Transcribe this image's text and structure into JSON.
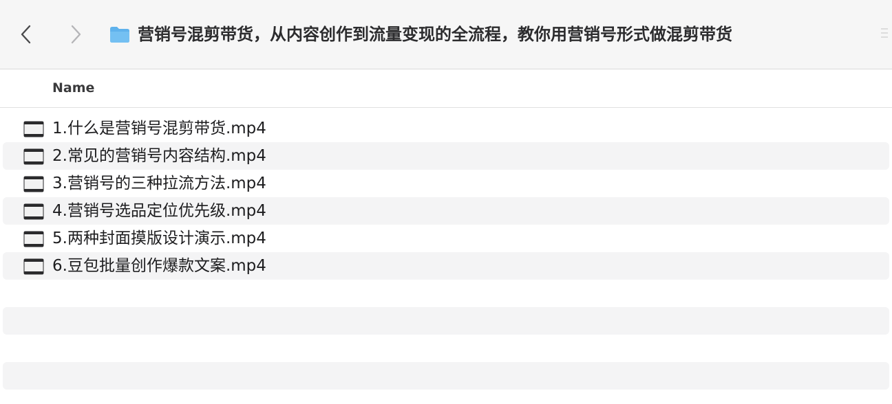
{
  "window": {
    "title": "营销号混剪带货，从内容创作到流量变现的全流程，教你用营销号形式做混剪带货"
  },
  "toolbar": {
    "back_icon": "chevron-left-icon",
    "forward_icon": "chevron-right-icon",
    "folder_icon": "folder-icon",
    "folder_color": "#5fb2ec"
  },
  "columns": {
    "name": "Name"
  },
  "files": [
    {
      "name": "1.什么是营销号混剪带货.mp4",
      "icon": "video-file-icon"
    },
    {
      "name": "2.常见的营销号内容结构.mp4",
      "icon": "video-file-icon"
    },
    {
      "name": "3.营销号的三种拉流方法.mp4",
      "icon": "video-file-icon"
    },
    {
      "name": "4.营销号选品定位优先级.mp4",
      "icon": "video-file-icon"
    },
    {
      "name": "5.两种封面摸版设计演示.mp4",
      "icon": "video-file-icon"
    },
    {
      "name": "6.豆包批量创作爆款文案.mp4",
      "icon": "video-file-icon"
    }
  ]
}
